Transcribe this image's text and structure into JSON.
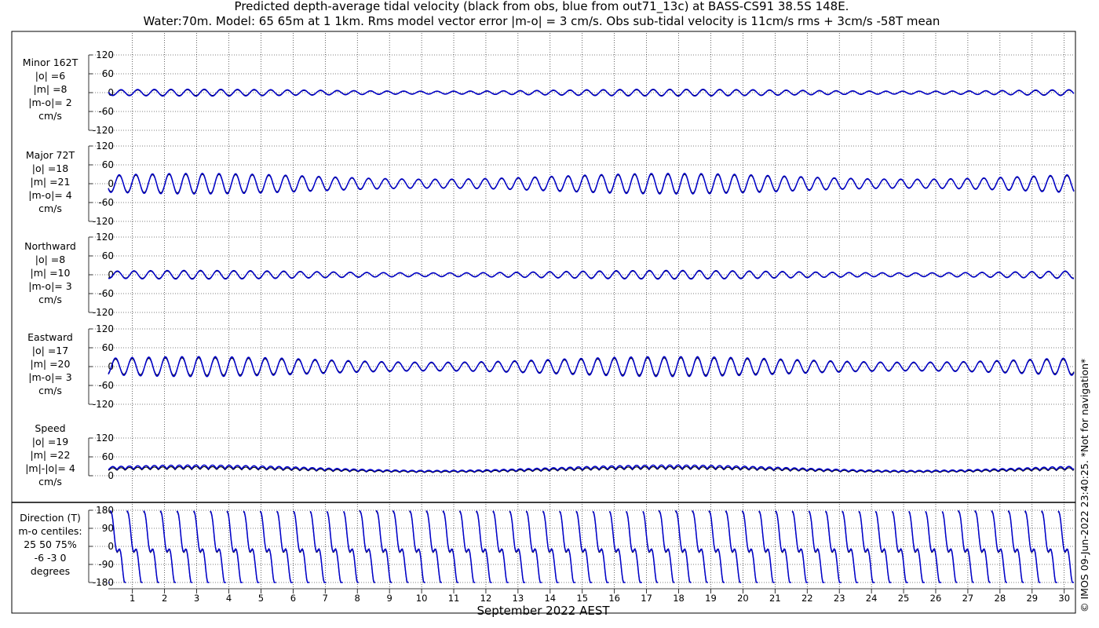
{
  "title_lines": [
    "Predicted depth-average tidal velocity (black from obs, blue from out71_13c) at BASS-CS91 38.5S 148E.",
    "Water:70m. Model: 65 65m at 1 1km. Rms model vector error |m-o| = 3 cm/s. Obs sub-tidal velocity is 11cm/s rms + 3cm/s -58T mean"
  ],
  "copyright": "© IMOS 09-Jun-2022 23:40:25. *Not for navigation*",
  "colors": {
    "obs": "#000000",
    "model": "#0000cc",
    "grid": "#000000"
  },
  "chart_data": {
    "type": "line",
    "xlabel": "September 2022 AEST",
    "x_ticks": [
      1,
      2,
      3,
      4,
      5,
      6,
      7,
      8,
      9,
      10,
      11,
      12,
      13,
      14,
      15,
      16,
      17,
      18,
      19,
      20,
      21,
      22,
      23,
      24,
      25,
      26,
      27,
      28,
      29,
      30
    ],
    "xlim": [
      0.25,
      30.3
    ],
    "grid": "dotted",
    "series_names": [
      "obs",
      "model"
    ],
    "panels": [
      {
        "id": "minor",
        "label_lines": [
          "Minor 162T",
          "|o| =6",
          "|m| =8",
          "|m-o|= 2",
          "cm/s"
        ],
        "ylim": [
          -120,
          120
        ],
        "yticks": [
          -120,
          -60,
          0,
          60,
          120
        ],
        "obs": {
          "amplitude": 9,
          "mean": 0
        },
        "model": {
          "amplitude": 11,
          "mean": 0
        }
      },
      {
        "id": "major",
        "label_lines": [
          "Major 72T",
          "|o| =18",
          "|m| =21",
          "|m-o|= 4",
          "cm/s"
        ],
        "ylim": [
          -120,
          120
        ],
        "yticks": [
          -120,
          -60,
          0,
          60,
          120
        ],
        "obs": {
          "amplitude": 30,
          "mean": 0
        },
        "model": {
          "amplitude": 33,
          "mean": 0
        }
      },
      {
        "id": "northward",
        "label_lines": [
          "Northward",
          "|o| =8",
          "|m| =10",
          "|m-o|= 3",
          "cm/s"
        ],
        "ylim": [
          -120,
          120
        ],
        "yticks": [
          -120,
          -60,
          0,
          60,
          120
        ],
        "obs": {
          "amplitude": 12,
          "mean": 0
        },
        "model": {
          "amplitude": 14,
          "mean": 0
        }
      },
      {
        "id": "eastward",
        "label_lines": [
          "Eastward",
          "|o| =17",
          "|m| =20",
          "|m-o|= 3",
          "cm/s"
        ],
        "ylim": [
          -120,
          120
        ],
        "yticks": [
          -120,
          -60,
          0,
          60,
          120
        ],
        "obs": {
          "amplitude": 28,
          "mean": 0
        },
        "model": {
          "amplitude": 32,
          "mean": 0
        }
      },
      {
        "id": "speed",
        "label_lines": [
          "Speed",
          "|o| =19",
          "|m| =22",
          "|m|-|o|= 4",
          "cm/s"
        ],
        "ylim": [
          0,
          120
        ],
        "yticks": [
          0,
          60,
          120
        ],
        "obs": {
          "amplitude": 10,
          "mean": 19
        },
        "model": {
          "amplitude": 12,
          "mean": 22
        }
      },
      {
        "id": "direction",
        "label_lines": [
          "Direction (T)",
          "m-o centiles:",
          "25  50  75%",
          "-6 -3  0",
          "degrees"
        ],
        "ylim": [
          -180,
          180
        ],
        "yticks": [
          -180,
          -90,
          0,
          90,
          180
        ],
        "obs": {
          "amplitude": 180,
          "mean": 0
        },
        "model": {
          "amplitude": 180,
          "mean": 0
        }
      }
    ],
    "tidal_period_days": 0.5175
  }
}
